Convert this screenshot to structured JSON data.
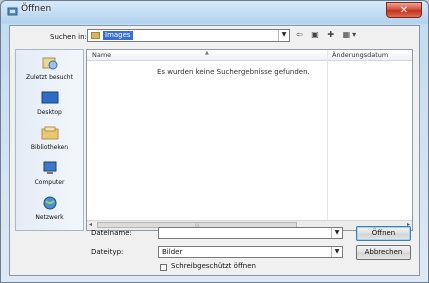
{
  "window": {
    "title": "Öffnen",
    "close_glyph": "✕"
  },
  "lookin": {
    "label": "Suchen in:",
    "value": "Images"
  },
  "toolbar": {
    "back": "⇦",
    "up": "▣",
    "newfolder": "✚",
    "view": "▦▾"
  },
  "places": [
    {
      "label": "Zuletzt besucht",
      "icon": "recent-places-icon"
    },
    {
      "label": "Desktop",
      "icon": "desktop-icon"
    },
    {
      "label": "Bibliotheken",
      "icon": "libraries-icon"
    },
    {
      "label": "Computer",
      "icon": "computer-icon"
    },
    {
      "label": "Netzwerk",
      "icon": "network-icon"
    }
  ],
  "filelist": {
    "columns": [
      "Name",
      "Änderungsdatum"
    ],
    "empty_message": "Es wurden keine Suchergebnisse gefunden."
  },
  "filename": {
    "label": "Dateiname:",
    "value": ""
  },
  "filetype": {
    "label": "Dateityp:",
    "value": "Bilder"
  },
  "buttons": {
    "open": "Öffnen",
    "cancel": "Abbrechen"
  },
  "readonly_checkbox": {
    "label": "Schreibgeschützt öffnen",
    "checked": false
  },
  "colors": {
    "selection": "#3a6fd2",
    "close": "#c4311d",
    "frame": "#b4d2ee"
  }
}
